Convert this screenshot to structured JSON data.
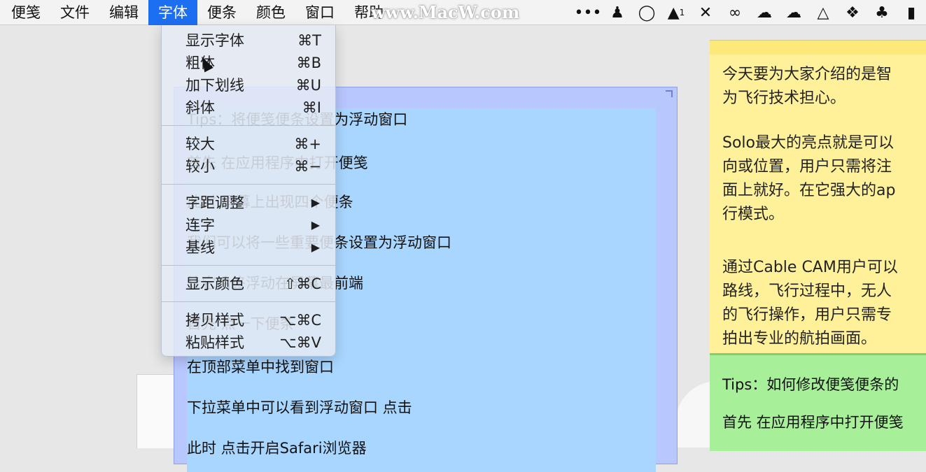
{
  "menubar": {
    "items": [
      "便笺",
      "文件",
      "编辑",
      "字体",
      "便条",
      "颜色",
      "窗口",
      "帮助"
    ],
    "active_index": 3,
    "watermark": "www.MacW.com",
    "tray_icons": [
      "dots-icon",
      "qq-icon",
      "refresh-icon",
      "adobe-icon",
      "unknown-app-icon",
      "creative-cloud-icon",
      "cloud-icon",
      "cloud-sync-icon",
      "google-drive-icon",
      "dropbox-icon",
      "evernote-icon",
      "clipboard-icon"
    ],
    "tray_text": {
      "adobe_badge": "1"
    }
  },
  "font_menu": {
    "groups": [
      [
        {
          "label": "显示字体",
          "shortcut": "⌘T"
        },
        {
          "label": "粗体",
          "shortcut": "⌘B"
        },
        {
          "label": "加下划线",
          "shortcut": "⌘U"
        },
        {
          "label": "斜体",
          "shortcut": "⌘I"
        }
      ],
      [
        {
          "label": "较大",
          "shortcut": "⌘+"
        },
        {
          "label": "较小",
          "shortcut": "⌘−"
        }
      ],
      [
        {
          "label": "字距调整",
          "submenu": true
        },
        {
          "label": "连字",
          "submenu": true
        },
        {
          "label": "基线",
          "submenu": true
        }
      ],
      [
        {
          "label": "显示颜色",
          "shortcut": "⇧⌘C"
        }
      ],
      [
        {
          "label": "拷贝样式",
          "shortcut": "⌥⌘C"
        },
        {
          "label": "粘贴样式",
          "shortcut": "⌥⌘V"
        }
      ]
    ],
    "submenu_arrow": "▶"
  },
  "blue_note": {
    "lines": [
      "Tips：将便笺便条设置为浮动窗口",
      "首先 在应用程序中打开便笺",
      "此时 屏幕上出现四个便条",
      "我们可以将一些重要便条设置为浮动窗口",
      "让它始终浮动在屏幕最前端",
      "首先 点一下便条",
      "在顶部菜单中找到窗口",
      "下拉菜单中可以看到浮动窗口 点击",
      "此时 点击开启Safari浏览器"
    ]
  },
  "yellow_note": {
    "paragraphs": [
      "今天要为大家介绍的是智\n为飞行技术担心。",
      "Solo最大的亮点就是可以\n向或位置，用户只需将注\n面上就好。在它强大的ap\n行模式。",
      "通过Cable CAM用户可以\n路线，飞行过程中，无人\n的飞行操作，用户只需专\n拍出专业的航拍画面。"
    ]
  },
  "green_note": {
    "lines": [
      "Tips：如何修改便笺便条的",
      "首先 在应用程序中打开便笺"
    ]
  }
}
